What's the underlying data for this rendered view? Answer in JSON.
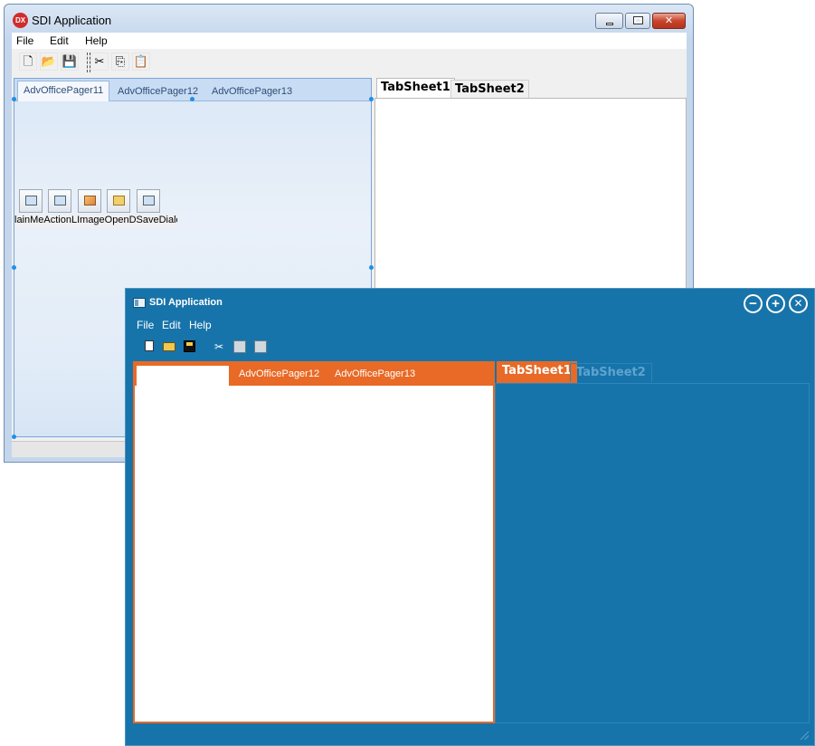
{
  "back_window": {
    "title": "SDI Application",
    "app_icon_text": "DX",
    "menu": {
      "file": "File",
      "edit": "Edit",
      "help": "Help"
    },
    "toolbar_icons": [
      "new-document-icon",
      "open-folder-icon",
      "save-icon",
      "cut-icon",
      "copy-icon",
      "paste-icon"
    ],
    "pager": {
      "tabs": [
        "AdvOfficePager11",
        "AdvOfficePager12",
        "AdvOfficePager13"
      ]
    },
    "components_label": "lainMeActionLImageOpenDSaveDialog",
    "tabsheets": [
      "TabSheet1",
      "TabSheet2"
    ]
  },
  "front_window": {
    "title": "SDI Application",
    "menu": {
      "file": "File",
      "edit": "Edit",
      "help": "Help"
    },
    "toolbar_icons": [
      "new-document-icon",
      "open-folder-icon",
      "save-icon",
      "cut-icon",
      "copy-icon",
      "paste-icon"
    ],
    "pager": {
      "tabs": [
        "",
        "AdvOfficePager12",
        "AdvOfficePager13"
      ]
    },
    "tabsheets": [
      "TabSheet1",
      "TabSheet2"
    ],
    "colors": {
      "background": "#1774aa",
      "accent": "#e86a26"
    }
  }
}
